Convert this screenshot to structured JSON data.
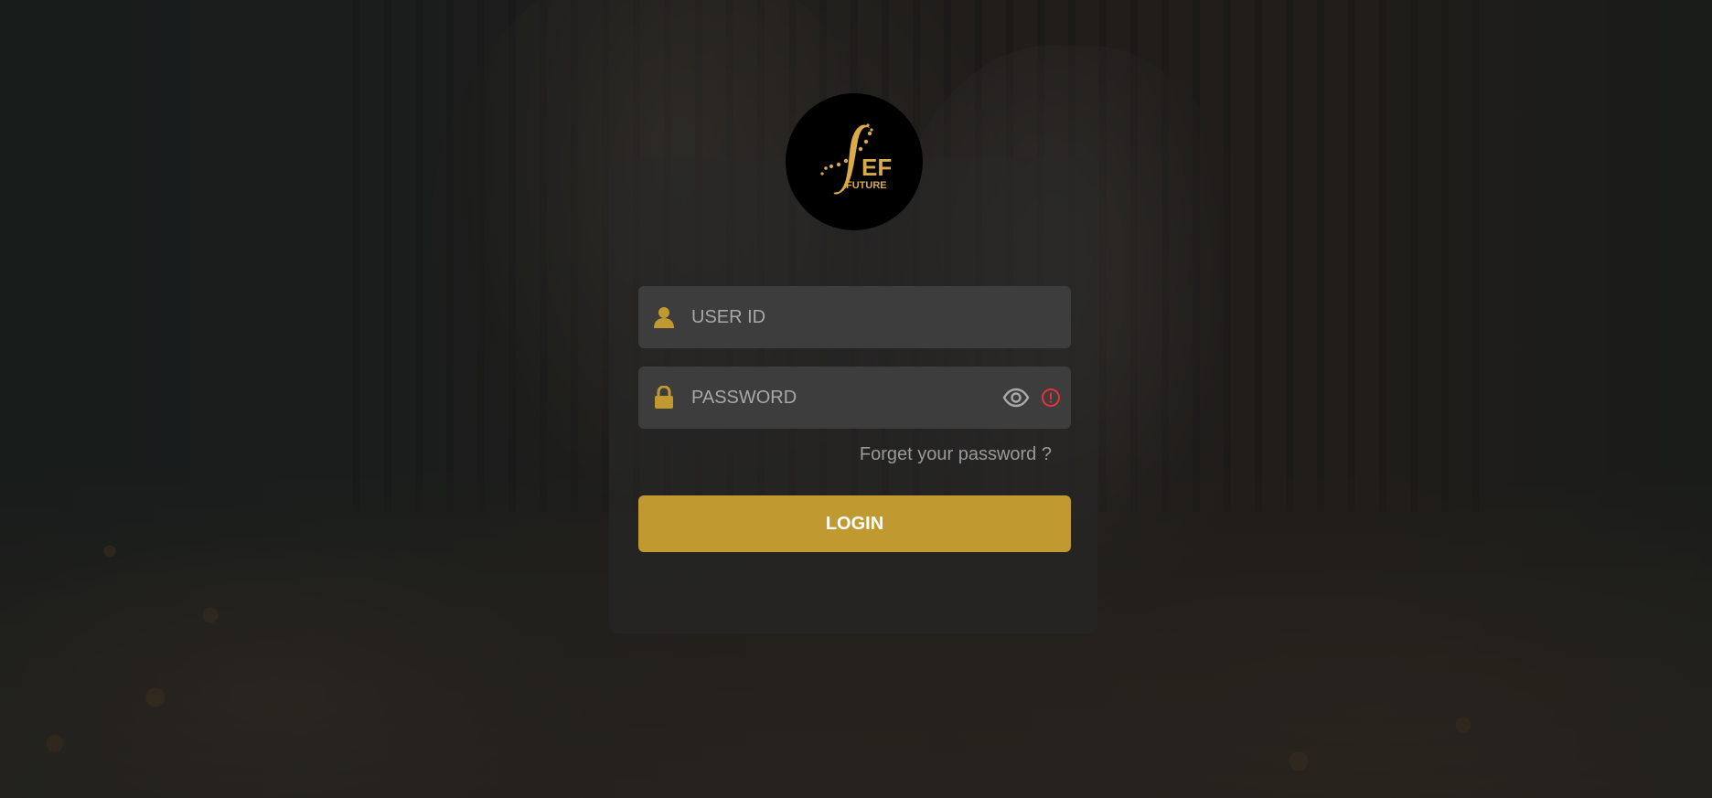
{
  "brand": {
    "logo_text_main": "EF",
    "logo_text_sub": "FUTURE",
    "logo_icon": "sef-future-logo-icon"
  },
  "form": {
    "user_id": {
      "placeholder": "USER ID",
      "value": "",
      "icon": "user-icon"
    },
    "password": {
      "placeholder": "PASSWORD",
      "value": "",
      "icon": "lock-icon",
      "toggle_icon": "eye-icon",
      "status_icon": "alert-circle-icon"
    },
    "forgot_label": "Forget your password ?",
    "login_label": "LOGIN"
  },
  "colors": {
    "accent_gold": "#c09a30",
    "field_bg": "#3d3d3d",
    "alert_red": "#e0333a",
    "logo_bg": "#000000"
  }
}
